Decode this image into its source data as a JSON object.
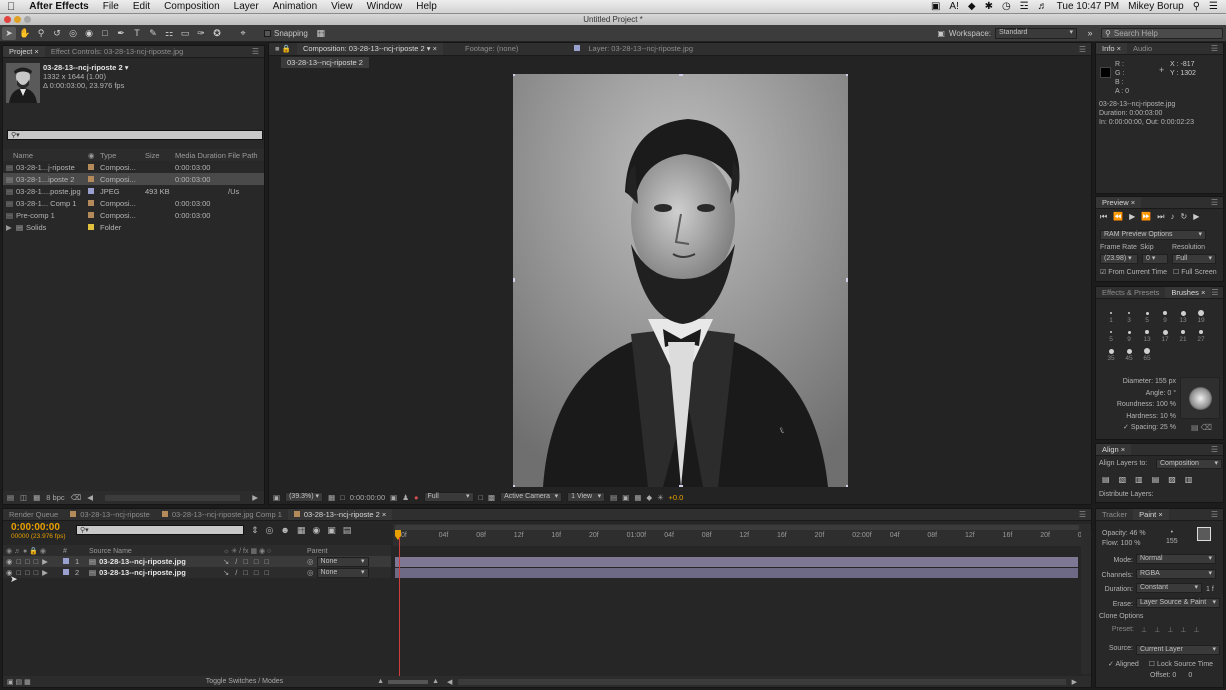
{
  "menubar": {
    "app": "After Effects",
    "items": [
      "File",
      "Edit",
      "Composition",
      "Layer",
      "Animation",
      "View",
      "Window",
      "Help"
    ],
    "clock": "Tue 10:47 PM",
    "user": "Mikey Borup"
  },
  "window_title": "Untitled Project *",
  "toolbar": {
    "snapping": "Snapping",
    "workspace_label": "Workspace:",
    "workspace_value": "Standard",
    "search_placeholder": "Search Help"
  },
  "project": {
    "tabs": [
      "Project",
      "Effect Controls: 03-28-13-ncj-riposte.jpg"
    ],
    "selected_name": "03-28-13--ncj-riposte 2",
    "selected_dims": "1332 x 1644 (1.00)",
    "selected_duration": "Δ 0:00:03:00, 23.976 fps",
    "columns": [
      "Name",
      "Type",
      "Size",
      "Media Duration",
      "File Path"
    ],
    "items": [
      {
        "name": "03-28-1...j-riposte",
        "type": "Composi...",
        "size": "",
        "duration": "0:00:03:00",
        "path": "",
        "color": "#b48a5a"
      },
      {
        "name": "03-28-1...iposte 2",
        "type": "Composi...",
        "size": "",
        "duration": "0:00:03:00",
        "path": "",
        "color": "#b48a5a"
      },
      {
        "name": "03-28-1....poste.jpg",
        "type": "JPEG",
        "size": "493 KB",
        "duration": "",
        "path": "/Us",
        "color": "#9aa0d0"
      },
      {
        "name": "03-28-1... Comp 1",
        "type": "Composi...",
        "size": "",
        "duration": "0:00:03:00",
        "path": "",
        "color": "#b48a5a"
      },
      {
        "name": "Pre-comp 1",
        "type": "Composi...",
        "size": "",
        "duration": "0:00:03:00",
        "path": "",
        "color": "#b48a5a"
      },
      {
        "name": "Solids",
        "type": "Folder",
        "size": "",
        "duration": "",
        "path": "",
        "color": "#e2c23c"
      }
    ],
    "bpc": "8 bpc"
  },
  "composition": {
    "tabs": [
      "Composition: 03-28-13--ncj-riposte 2",
      "Footage: (none)",
      "Layer: 03-28-13--ncj-riposte.jpg"
    ],
    "subtab": "03-28-13--ncj-riposte 2",
    "zoom": "(39.3%)",
    "time": "0:00:00:00",
    "resolution": "Full",
    "camera": "Active Camera",
    "view": "1 View",
    "exposure": "+0.0"
  },
  "info": {
    "tabs": [
      "Info",
      "Audio"
    ],
    "r": "R :",
    "g": "G :",
    "b": "B :",
    "a": "A : 0",
    "x": "X : -817",
    "y": "Y : 1302",
    "file": "03-28-13--ncj-riposte.jpg",
    "duration": "Duration: 0:00:03:00",
    "inout": "In: 0:00:00:00, Out: 0:00:02:23"
  },
  "preview": {
    "tab": "Preview",
    "ram": "RAM Preview Options",
    "frame_rate_label": "Frame Rate",
    "skip_label": "Skip",
    "resolution_label": "Resolution",
    "frame_rate": "(23.98)",
    "skip": "0",
    "resolution": "Full",
    "from_current": "From Current Time",
    "full_screen": "Full Screen"
  },
  "brushes": {
    "tabs": [
      "Effects & Presets",
      "Brushes"
    ],
    "sizes": [
      "1",
      "3",
      "5",
      "9",
      "13",
      "19",
      "5",
      "9",
      "13",
      "17",
      "21",
      "27",
      "35",
      "45",
      "65"
    ],
    "diameter": "Diameter: 155 px",
    "angle": "Angle: 0 °",
    "roundness": "Roundness: 100 %",
    "hardness": "Hardness: 10 %",
    "spacing": "Spacing: 25 %"
  },
  "align": {
    "tab": "Align",
    "layers_to": "Align Layers to:",
    "target": "Composition",
    "distribute": "Distribute Layers:"
  },
  "paint": {
    "tabs": [
      "Tracker",
      "Paint"
    ],
    "opacity": "Opacity: 46 %",
    "flow": "Flow: 100 %",
    "brush_size": "155",
    "mode_label": "Mode:",
    "mode": "Normal",
    "channels_label": "Channels:",
    "channels": "RGBA",
    "duration_label": "Duration:",
    "duration": "Constant",
    "duration_f": "1 f",
    "erase_label": "Erase:",
    "erase": "Layer Source & Paint",
    "clone_options": "Clone Options",
    "preset_label": "Preset:",
    "source_label": "Source:",
    "source": "Current Layer",
    "aligned": "Aligned",
    "lock_source": "Lock Source Time",
    "offset": "Offset: 0",
    "offset2": "0"
  },
  "timeline": {
    "tabs": [
      "Render Queue",
      "03-28-13--ncj-riposte",
      "03-28-13--ncj-riposte.jpg Comp 1",
      "03-28-13--ncj-riposte 2"
    ],
    "timecode": "0:00:00:00",
    "fps": "00000 (23.976 fps)",
    "col_num": "#",
    "col_source": "Source Name",
    "col_parent": "Parent",
    "layers": [
      {
        "num": "1",
        "name": "03-28-13--ncj-riposte.jpg",
        "parent": "None"
      },
      {
        "num": "2",
        "name": "03-28-13--ncj-riposte.jpg",
        "parent": "None"
      }
    ],
    "ruler": [
      "0f",
      "04f",
      "08f",
      "12f",
      "16f",
      "20f",
      "01:00f",
      "04f",
      "08f",
      "12f",
      "16f",
      "20f",
      "02:00f",
      "04f",
      "08f",
      "12f",
      "16f",
      "20f",
      "03:0"
    ],
    "toggle": "Toggle Switches / Modes"
  },
  "colors": {
    "accent": "#e8a000",
    "layer_bar": "#8e87a8",
    "playhead": "#d23c3c",
    "panel": "#282828"
  }
}
